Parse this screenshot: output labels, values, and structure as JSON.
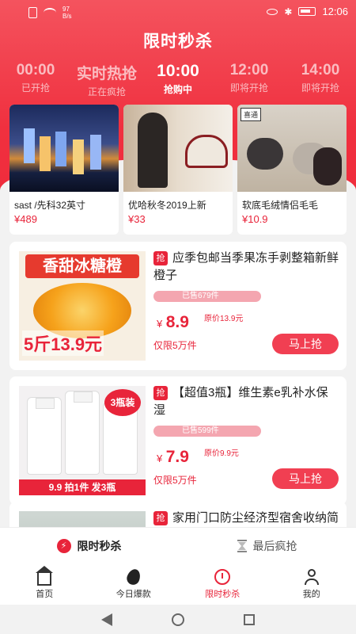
{
  "status_bar": {
    "net_speed_value": "97",
    "net_speed_unit": "B/s",
    "time": "12:06"
  },
  "header": {
    "title": "限时秒杀"
  },
  "time_tabs": [
    {
      "time": "00:00",
      "status": "已开抢"
    },
    {
      "time": "实时热抢",
      "status": "正在疯抢"
    },
    {
      "time": "10:00",
      "status": "抢购中"
    },
    {
      "time": "12:00",
      "status": "即将开抢"
    },
    {
      "time": "14:00",
      "status": "即将开抢"
    }
  ],
  "top_products": [
    {
      "name": "sast /先科32英寸",
      "price": "¥489"
    },
    {
      "name": "优哈秋冬2019上新",
      "price": "¥33"
    },
    {
      "name": "软底毛绒情侣毛毛",
      "price": "¥10.9",
      "brand": "喜通"
    }
  ],
  "products": [
    {
      "tag": "抢",
      "title": "应季包邮当季果冻手剥整箱新鲜橙子",
      "sold": "已售679件",
      "currency": "¥",
      "price": "8.9",
      "original_price": "原价13.9元",
      "limit": "仅限5万件",
      "buy_label": "马上抢",
      "image_banner": "香甜冰糖橙",
      "image_offer": "5斤13.9元"
    },
    {
      "tag": "抢",
      "title": "【超值3瓶】维生素e乳补水保湿",
      "sold": "已售599件",
      "currency": "¥",
      "price": "7.9",
      "original_price": "原价9.9元",
      "limit": "仅限5万件",
      "buy_label": "马上抢",
      "image_badge": "3瓶装",
      "image_strip": "9.9 拍1件 发3瓶"
    },
    {
      "tag": "抢",
      "title": "家用门口防尘经济型宿舍收纳简易子"
    }
  ],
  "segments": [
    {
      "label": "限时秒杀",
      "icon": "bolt-icon"
    },
    {
      "label": "最后疯抢",
      "icon": "hourglass-icon"
    }
  ],
  "tabbar": [
    {
      "label": "首页",
      "icon": "home-icon"
    },
    {
      "label": "今日爆款",
      "icon": "flame-icon"
    },
    {
      "label": "限时秒杀",
      "icon": "clock-icon"
    },
    {
      "label": "我的",
      "icon": "user-icon"
    }
  ],
  "colors": {
    "accent": "#e8243a",
    "hero_top": "#f4535e",
    "hero_bottom": "#ef2b3b",
    "sold_bar": "#f4a6b0"
  }
}
